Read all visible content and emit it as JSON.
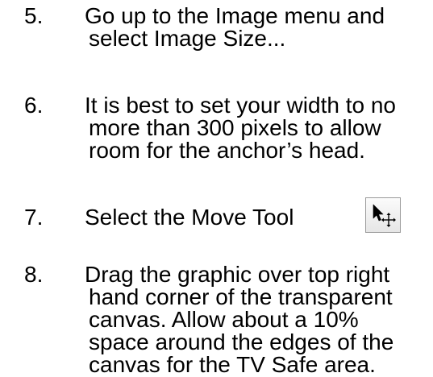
{
  "steps": [
    {
      "number": "5.",
      "lines": [
        "Go up to the Image menu and",
        "select Image Size..."
      ]
    },
    {
      "number": "6.",
      "lines": [
        "It is best to set your width to no",
        "more than 300 pixels to allow",
        "room for the anchor’s head."
      ]
    },
    {
      "number": "7.",
      "lines": [
        "Select the Move Tool"
      ],
      "icon": "move-tool-icon"
    },
    {
      "number": "8.",
      "lines": [
        "Drag the graphic over top right",
        "hand corner of the transparent",
        "canvas. Allow about a 10%",
        "space around the edges of the",
        "canvas for the TV Safe area."
      ]
    }
  ],
  "colors": {
    "text": "#000000",
    "icon_border": "#9a9a9a"
  }
}
